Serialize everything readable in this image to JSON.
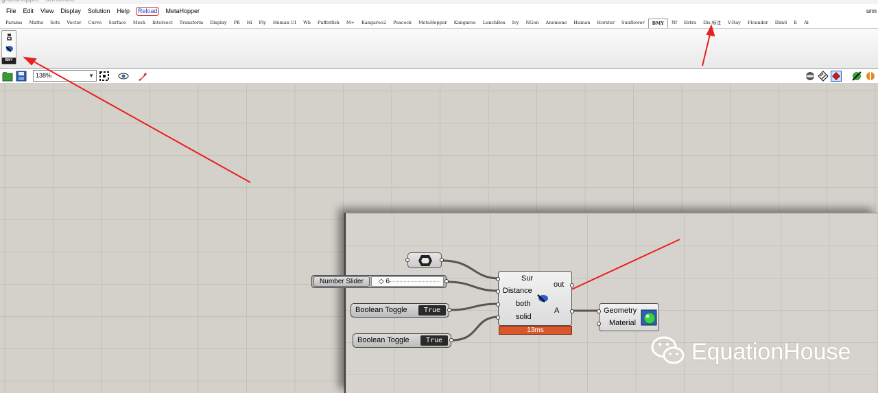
{
  "menubar": {
    "items": [
      "File",
      "Edit",
      "View",
      "Display",
      "Solution",
      "Help",
      "Reload",
      "MetaHopper"
    ],
    "doc_name": "unn"
  },
  "tabs": [
    "Params",
    "Maths",
    "Sets",
    "Vector",
    "Curve",
    "Surface",
    "Mesh",
    "Intersect",
    "Transform",
    "Display",
    "PK",
    "Hi",
    "Fly",
    "Human UI",
    "Wb",
    "Pufferfish",
    "M+",
    "Kangaroo2",
    "Peacock",
    "MetaHopper",
    "Kangaroo",
    "LunchBox",
    "Ivy",
    "NGon",
    "Anemone",
    "Human",
    "Horster",
    "Sunflower",
    "BMY",
    "Nf",
    "Extra",
    "Dis-标注",
    "V-Ray",
    "Flounder",
    "Dim6",
    "E",
    "Al"
  ],
  "ribbon": {
    "caption": "BMY"
  },
  "toolbar": {
    "zoom": "138%"
  },
  "components": {
    "slider": {
      "label": "Number Slider",
      "value": "6",
      "glyph": "◇"
    },
    "toggle1": {
      "label": "Boolean Toggle",
      "value": "True"
    },
    "toggle2": {
      "label": "Boolean Toggle",
      "value": "True"
    },
    "main": {
      "inputs": [
        "Sur",
        "Distance",
        "both",
        "solid"
      ],
      "outputs": [
        "out",
        "A"
      ],
      "time": "13ms"
    },
    "preview": {
      "inputs": [
        "Geometry",
        "Material"
      ]
    }
  },
  "watermark": "EquationHouse",
  "colors": {
    "canvas": "#d4d1cb",
    "arrow": "#e8201f",
    "time_bar": "#d8582c"
  }
}
